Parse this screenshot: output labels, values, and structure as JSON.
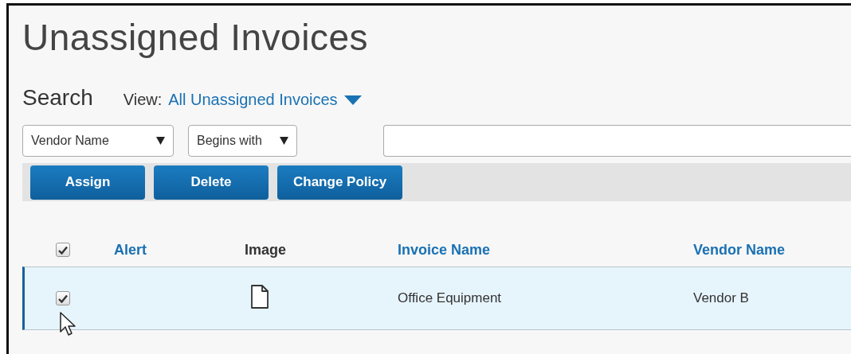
{
  "page": {
    "title": "Unassigned Invoices"
  },
  "search": {
    "label": "Search",
    "view_label": "View:",
    "view_value": "All Unassigned Invoices"
  },
  "filters": [
    {
      "kind": "dropdown",
      "value": "Vendor Name"
    },
    {
      "kind": "dropdown",
      "value": "Begins with"
    },
    {
      "kind": "text"
    }
  ],
  "buttons": [
    "Assign",
    "Delete",
    "Change Policy"
  ],
  "table": {
    "select_all": {
      "checked": true
    },
    "columns": [
      {
        "label": "Alert",
        "sortable": true
      },
      {
        "label": "Image",
        "sortable": false
      },
      {
        "label": "Invoice Name",
        "sortable": true
      },
      {
        "label": "Vendor Name",
        "sortable": true
      }
    ],
    "rows": [
      {
        "checked": true,
        "selected": true,
        "has_image": true,
        "invoice_name": "Office Equipment",
        "vendor_name": "Vendor B"
      }
    ]
  }
}
